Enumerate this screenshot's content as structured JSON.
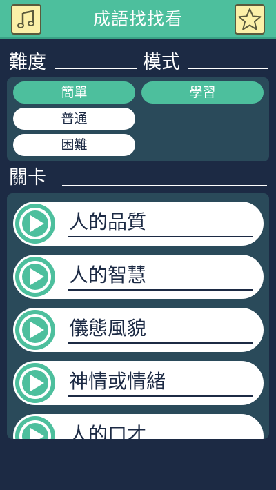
{
  "header": {
    "title": "成語找找看",
    "music_icon": "music-note-icon",
    "star_icon": "star-icon"
  },
  "difficulty": {
    "label": "難度",
    "options": [
      "簡單",
      "普通",
      "困難"
    ],
    "selected": "簡單"
  },
  "mode": {
    "label": "模式",
    "options": [
      "學習"
    ],
    "selected": "學習"
  },
  "levels": {
    "label": "關卡",
    "items": [
      "人的品質",
      "人的智慧",
      "儀態風貌",
      "神情或情緒",
      "人的口才"
    ]
  },
  "colors": {
    "accent": "#4dbf9d",
    "background": "#1c2a44",
    "panel": "#2a4a5a",
    "icon_button": "#fbf0a8"
  }
}
